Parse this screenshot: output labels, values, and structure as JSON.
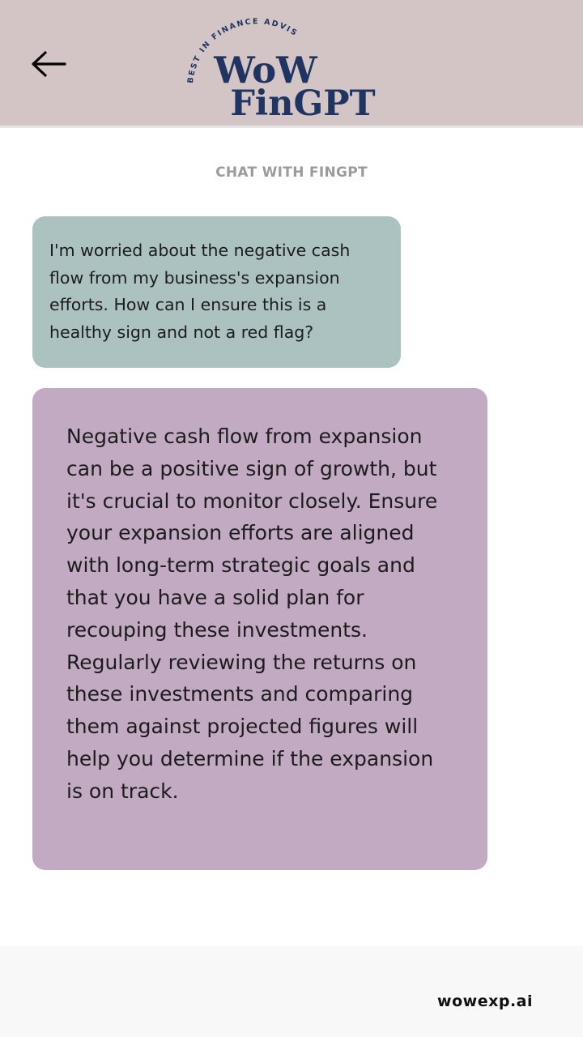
{
  "header": {
    "back_icon": "arrow-left-icon",
    "logo": {
      "arc_text": "BEST IN FINANCE ADVISORY",
      "line1": "WoW",
      "line2": "FinGPT"
    },
    "background_color": "#d3c5c6",
    "brand_color": "#1f3460"
  },
  "chat": {
    "title": "CHAT WITH FINGPT",
    "messages": [
      {
        "role": "user",
        "color": "#abc2c0",
        "lines": [
          "I'm worried about the negative cash",
          "flow from my business's expansion",
          "efforts. How can I ensure this is a",
          "healthy sign and not a red flag?"
        ]
      },
      {
        "role": "assistant",
        "color": "#c3aac3",
        "lines": [
          "Negative cash flow from expansion",
          "can be a positive sign of growth, but",
          "it's crucial to monitor closely. Ensure",
          "your expansion efforts are aligned",
          "with long-term strategic goals and",
          "that you have a solid plan for",
          "recouping these investments.",
          "Regularly reviewing the returns on",
          "these investments and comparing",
          "them against projected figures will",
          "help you determine if the expansion",
          "is on track."
        ]
      }
    ]
  },
  "footer": {
    "link_text": "wowexp.ai"
  }
}
